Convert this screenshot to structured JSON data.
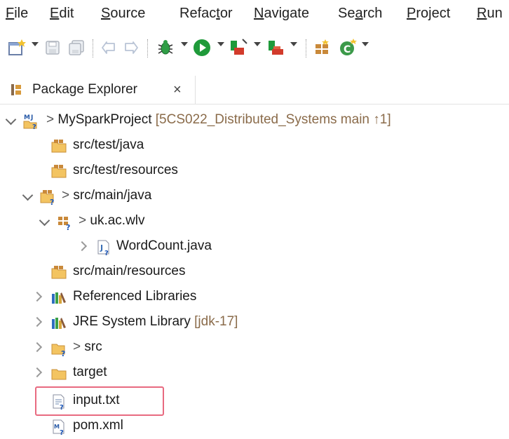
{
  "menu": [
    {
      "label": "File",
      "pre": "",
      "mn": "F",
      "post": "ile"
    },
    {
      "label": "Edit",
      "pre": "",
      "mn": "E",
      "post": "dit"
    },
    {
      "label": "Source",
      "pre": "",
      "mn": "S",
      "post": "ource"
    },
    {
      "label": "Refactor",
      "pre": "Refac",
      "mn": "t",
      "post": "or"
    },
    {
      "label": "Navigate",
      "pre": "",
      "mn": "N",
      "post": "avigate"
    },
    {
      "label": "Search",
      "pre": "Se",
      "mn": "a",
      "post": "rch"
    },
    {
      "label": "Project",
      "pre": "",
      "mn": "P",
      "post": "roject"
    },
    {
      "label": "Run",
      "pre": "",
      "mn": "R",
      "post": "un"
    }
  ],
  "tab": {
    "label": "Package Explorer",
    "close": "×"
  },
  "tree": {
    "project": {
      "prefix": ">",
      "name": "MySparkProject",
      "decoration": "[5CS022_Distributed_Systems main ↑1]"
    },
    "src_test_java": "src/test/java",
    "src_test_resources": "src/test/resources",
    "src_main_java": {
      "prefix": ">",
      "name": "src/main/java"
    },
    "package": {
      "prefix": ">",
      "name": "uk.ac.wlv"
    },
    "wordcount": "WordCount.java",
    "src_main_resources": "src/main/resources",
    "referenced_libraries": "Referenced Libraries",
    "jre": {
      "name": "JRE System Library",
      "decoration": "[jdk-17]"
    },
    "src": {
      "prefix": ">",
      "name": "src"
    },
    "target": "target",
    "input": "input.txt",
    "pom": "pom.xml"
  },
  "colors": {
    "highlight": "#e86a80",
    "decoration": "#8a6b4a",
    "run_green": "#1f9a3a"
  }
}
